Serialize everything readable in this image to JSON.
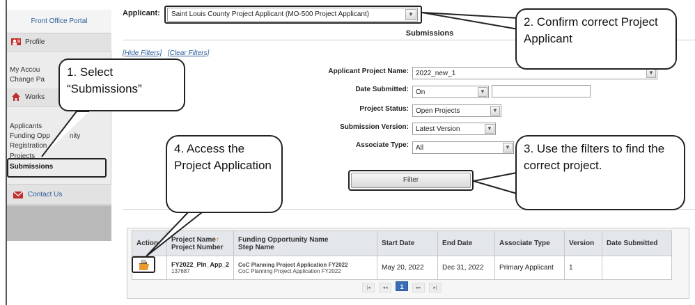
{
  "sidebar": {
    "portal": "Front Office Portal",
    "profile": "Profile",
    "my_account": "My Accou",
    "change_password": "Change Pa",
    "workspace": "Works",
    "applicants": "Applicants",
    "funding_opportunity": "Funding Opp",
    "funding_opportunity_tail": "nity",
    "registrations": "Registration",
    "projects": "Projects",
    "submissions": "Submissions",
    "contact_us": "Contact Us"
  },
  "header": {
    "applicant_label": "Applicant:",
    "applicant_value": "Saint Louis County Project Applicant (MO-500 Project Applicant)",
    "section_title": "Submissions"
  },
  "filters": {
    "hide": "[Hide Filters]",
    "clear": "[Clear Filters]",
    "rows": [
      {
        "label": "Applicant Project Name:",
        "value": "2022_new_1"
      },
      {
        "label": "Date Submitted:",
        "value": "On"
      },
      {
        "label": "Project Status:",
        "value": "Open Projects"
      },
      {
        "label": "Submission Version:",
        "value": "Latest Version"
      },
      {
        "label": "Associate Type:",
        "value": "All"
      }
    ],
    "button": "Filter"
  },
  "table": {
    "headers": {
      "actions": "Actions",
      "project_name": "Project Name",
      "project_number": "Project Number",
      "fo_name": "Funding Opportunity Name",
      "step_name": "Step Name",
      "start_date": "Start Date",
      "end_date": "End Date",
      "associate_type": "Associate Type",
      "version": "Version",
      "date_submitted": "Date Submitted"
    },
    "rows": [
      {
        "project_name": "FY2022_Pln_App_2",
        "project_number": "137687",
        "fo_name": "CoC Planning Project Application FY2022",
        "step_name": "CoC Planning Project Application FY2022",
        "start_date": "May 20, 2022",
        "end_date": "Dec 31, 2022",
        "associate_type": "Primary Applicant",
        "version": "1",
        "date_submitted": ""
      }
    ],
    "pager": {
      "first": "|◂",
      "prev": "◂◂",
      "current": "1",
      "next": "▸▸",
      "last": "▸|"
    }
  },
  "callouts": {
    "c1": "1. Select “Submissions”",
    "c2": "2. Confirm correct Project Applicant",
    "c3": "3. Use the filters to find the correct project.",
    "c4": "4. Access the Project Application"
  },
  "colors": {
    "link_blue": "#2a5d9a",
    "header_gray": "#e3e6ea",
    "sidebar_bg": "#ececec"
  },
  "icons": [
    "profile-icon",
    "home-icon",
    "mail-icon",
    "open-folder-icon",
    "sort-up-arrow-icon"
  ]
}
